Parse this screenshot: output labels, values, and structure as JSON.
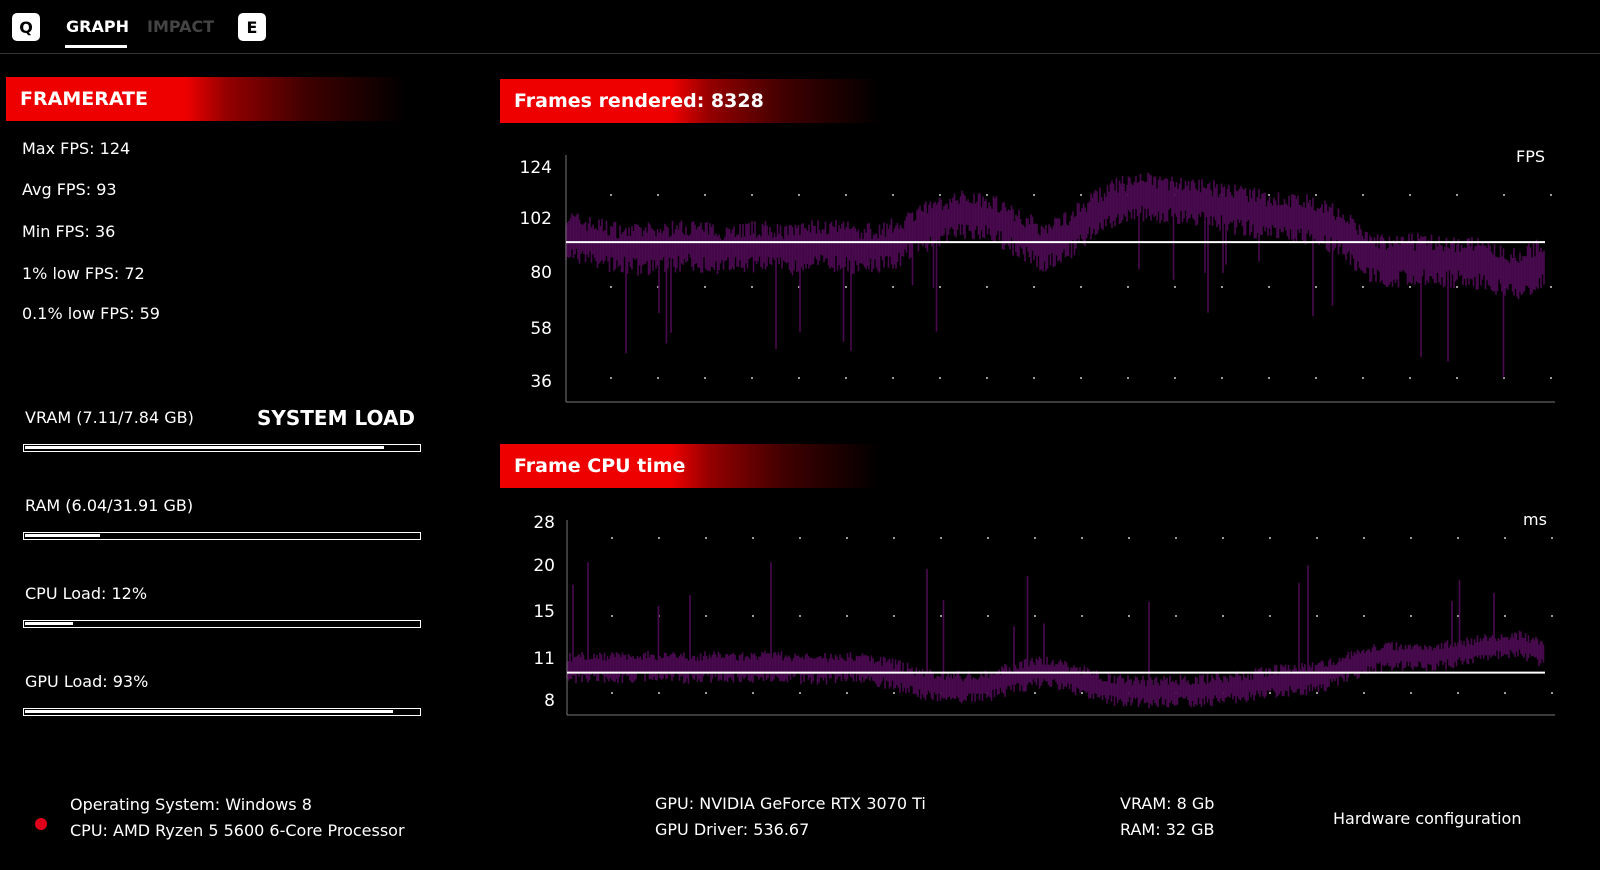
{
  "tabs": {
    "q_key": "Q",
    "graph": "GRAPH",
    "impact": "IMPACT",
    "e_key": "E"
  },
  "framerate": {
    "title": "FRAMERATE",
    "stats": [
      "Max FPS: 124",
      "Avg FPS: 93",
      "Min FPS: 36",
      "1% low FPS: 72",
      "0.1% low FPS: 59"
    ]
  },
  "system_load": {
    "title": "SYSTEM LOAD",
    "bars": [
      {
        "label": "VRAM (7.11/7.84 GB)",
        "value": 0.907
      },
      {
        "label": "RAM (6.04/31.91 GB)",
        "value": 0.189
      },
      {
        "label": "CPU Load: 12%",
        "value": 0.12
      },
      {
        "label": "GPU Load: 93%",
        "value": 0.93
      }
    ]
  },
  "footer": {
    "os": "Operating System: Windows 8",
    "cpu": "CPU: AMD Ryzen 5 5600 6-Core Processor",
    "gpu": "GPU: NVIDIA GeForce RTX 3070 Ti",
    "driver": "GPU Driver: 536.67",
    "vram": "VRAM: 8 Gb",
    "ram": "RAM: 32 GB",
    "hw": "Hardware configuration",
    "status_color": "#e0001a"
  },
  "chart_data": [
    {
      "type": "line",
      "title": "Frames rendered: 8328",
      "unit": "FPS",
      "yticks": [
        124,
        102,
        80,
        58,
        36
      ],
      "ylim": [
        28,
        130
      ],
      "average": 93,
      "color": "#4a0a4f",
      "values": [
        96,
        93,
        91,
        90,
        91,
        92,
        90,
        91,
        91,
        90,
        92,
        91,
        90,
        92,
        98,
        102,
        105,
        103,
        97,
        91,
        96,
        104,
        110,
        112,
        111,
        110,
        108,
        106,
        104,
        103,
        102,
        96,
        87,
        85,
        86,
        85,
        85,
        82,
        80,
        85
      ]
    },
    {
      "type": "line",
      "title": "Frame CPU time",
      "unit": "ms",
      "yticks": [
        28,
        20,
        15,
        11,
        8
      ],
      "ylim": [
        7,
        30
      ],
      "average": 10.1,
      "color": "#4a0a4f",
      "values": [
        10.4,
        10.6,
        10.5,
        10.6,
        10.5,
        10.5,
        10.6,
        10.5,
        10.6,
        10.5,
        10.4,
        10.5,
        10.4,
        10,
        9.4,
        9.1,
        9.0,
        9.3,
        9.8,
        10.2,
        9.8,
        9.2,
        8.8,
        8.7,
        8.8,
        8.8,
        8.9,
        9.1,
        9.4,
        9.6,
        9.8,
        10.4,
        11.2,
        11.4,
        11.3,
        11.5,
        11.8,
        12.2,
        12.3,
        11.6
      ]
    }
  ]
}
